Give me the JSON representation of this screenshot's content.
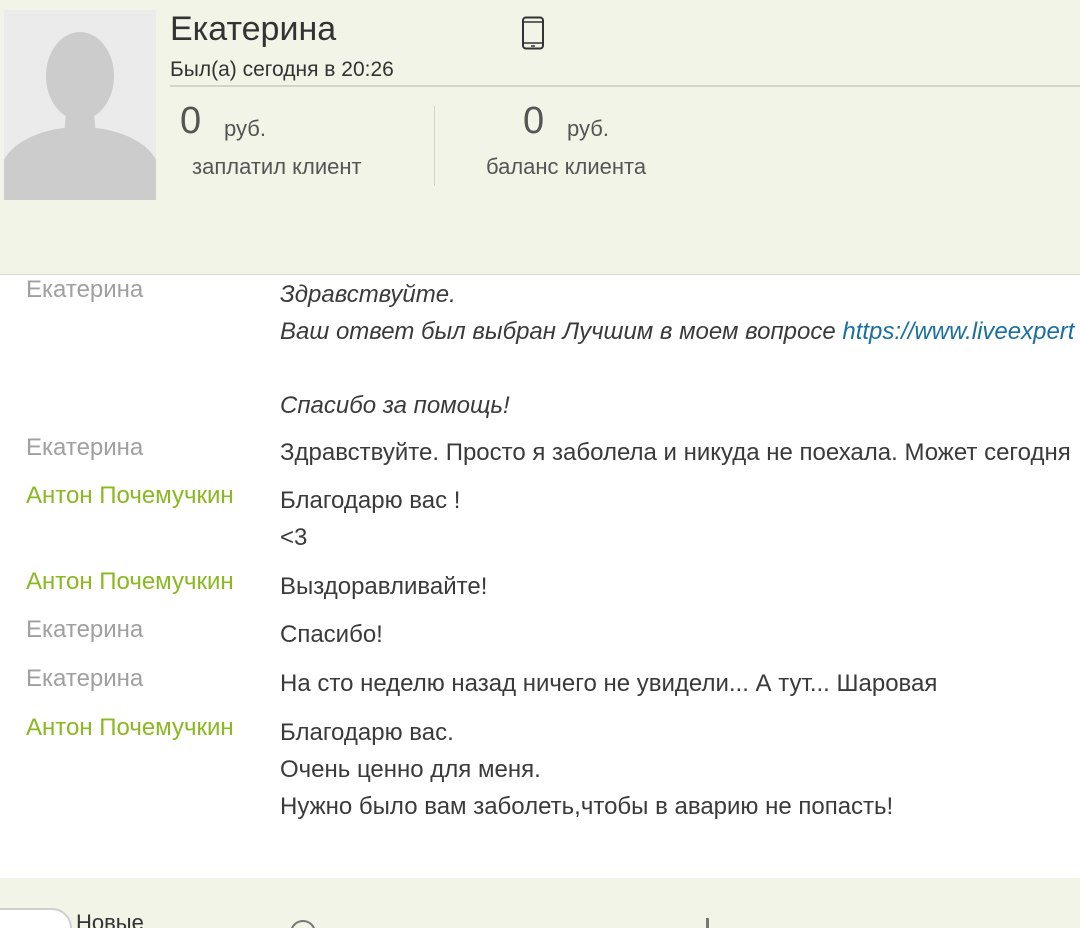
{
  "client": {
    "name": "Екатерина",
    "last_seen": "Был(а) сегодня в 20:26",
    "device_icon": "smartphone-icon",
    "avatar_icon": "default-user-silhouette"
  },
  "stats": {
    "paid": {
      "value": "0",
      "unit": "руб.",
      "caption": "заплатил клиент"
    },
    "balance": {
      "value": "0",
      "unit": "руб.",
      "caption": "баланс клиента"
    }
  },
  "colors": {
    "header_bg": "#f1f4e6",
    "client_author": "#a0a0a0",
    "expert_author": "#8ab821",
    "link": "#1a6fa0"
  },
  "messages": [
    {
      "author": "Екатерина",
      "line1": "Здравствуйте.",
      "line2_text": "Ваш ответ был выбран Лучшим в моем вопросе ",
      "line2_link": "https://www.liveexpert",
      "line3": "Спасибо за помощь!"
    },
    {
      "author": "Екатерина",
      "line1": "Здравствуйте. Просто я заболела и никуда не поехала. Может сегодня"
    },
    {
      "author": "Антон Почемучкин",
      "line1": "Благодарю вас !",
      "line2": "<3"
    },
    {
      "author": "Антон Почемучкин",
      "line1": "Выздоравливайте!"
    },
    {
      "author": "Екатерина",
      "line1": "Спасибо!"
    },
    {
      "author": "Екатерина",
      "line1": "На сто неделю назад ничего не увидели... А тут... Шаровая"
    },
    {
      "author": "Антон Почемучкин",
      "line1": "Благодарю вас.",
      "line2": "Очень ценно для меня.",
      "line3": "Нужно было вам заболеть,чтобы в аварию не попасть!"
    }
  ],
  "footer": {
    "new_label": "Новые"
  }
}
